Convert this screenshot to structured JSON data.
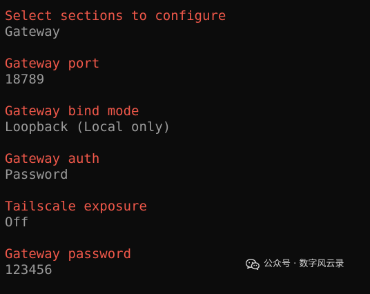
{
  "colors": {
    "background": "#0c0c0c",
    "prompt": "#f0584a",
    "answer": "#9b9b9b",
    "watermark": "#d8d8d8"
  },
  "terminal": {
    "entries": [
      {
        "prompt": "Select sections to configure",
        "answer": "Gateway"
      },
      {
        "prompt": "Gateway port",
        "answer": "18789"
      },
      {
        "prompt": "Gateway bind mode",
        "answer": "Loopback (Local only)"
      },
      {
        "prompt": "Gateway auth",
        "answer": "Password"
      },
      {
        "prompt": "Tailscale exposure",
        "answer": "Off"
      },
      {
        "prompt": "Gateway password",
        "answer": "123456"
      }
    ]
  },
  "watermark": {
    "icon": "wechat-icon",
    "text": "公众号 · 数字风云录"
  }
}
